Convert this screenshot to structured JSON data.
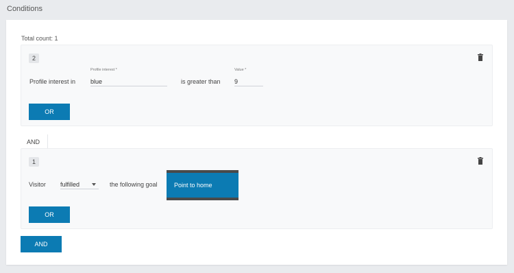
{
  "header": {
    "title": "Conditions"
  },
  "summary": {
    "total_count": "Total count: 1"
  },
  "groups": [
    {
      "index": "2",
      "prefix": "Profile interest in",
      "interest_field": {
        "label": "Profile interest *",
        "value": "blue"
      },
      "operator": "is greater than",
      "value_field": {
        "label": "Value *",
        "value": "9"
      },
      "or_label": "OR"
    },
    {
      "index": "1",
      "prefix": "Visitor",
      "status_select": {
        "value": "fulfilled"
      },
      "middle_text": "the following goal",
      "goal": "Point to home",
      "or_label": "OR"
    }
  ],
  "and_tab": "AND",
  "and_button": "AND",
  "colors": {
    "accent": "#0c7bb3",
    "background": "#e9ebee"
  },
  "icons": {
    "delete": "trash-icon",
    "dropdown": "caret-down-icon"
  }
}
